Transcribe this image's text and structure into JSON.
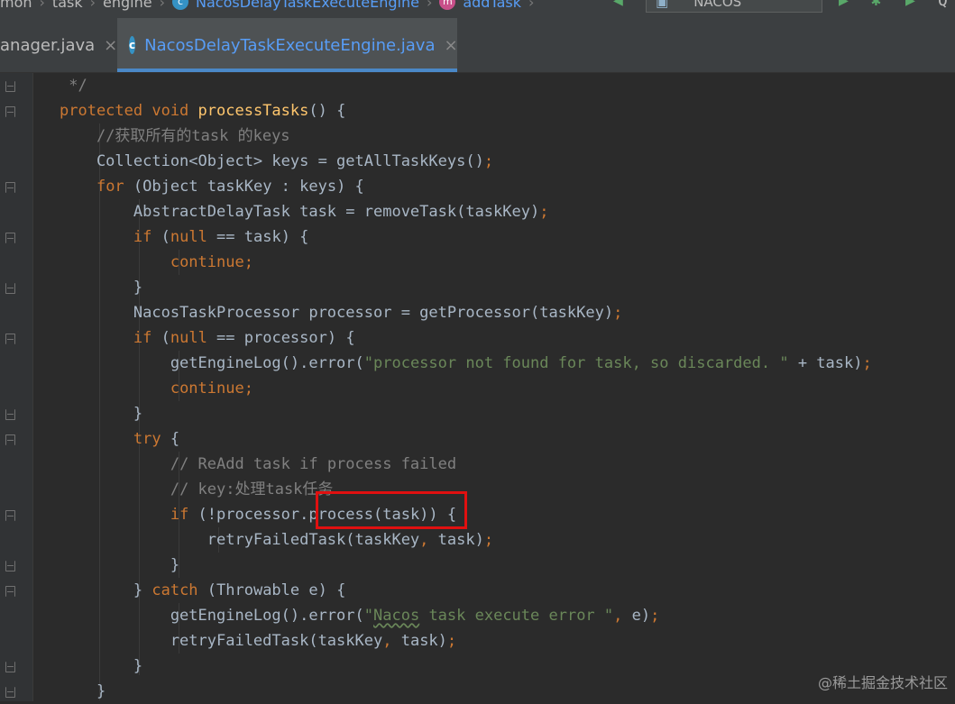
{
  "breadcrumb": [
    {
      "label": "mon"
    },
    {
      "label": "task"
    },
    {
      "label": "engine"
    },
    {
      "label": "NacosDelayTaskExecuteEngine"
    },
    {
      "label": "addTask"
    }
  ],
  "run_config": {
    "label": "NACOS"
  },
  "tabs": [
    {
      "label": "anager.java",
      "active": false
    },
    {
      "label": "NacosDelayTaskExecuteEngine.java",
      "active": true
    }
  ],
  "code_lines": [
    "<span class=\"cm\"> */</span>",
    "<span class=\"kw\">protected void </span><span class=\"fn\">processTasks</span>() {",
    "    <span class=\"cm\">//获取所有的task 的keys</span>",
    "    Collection&lt;Object&gt; keys = getAllTaskKeys()<span class=\"kw\">;</span>",
    "    <span class=\"kw\">for </span>(Object taskKey : keys) {",
    "        AbstractDelayTask task = removeTask(taskKey)<span class=\"kw\">;</span>",
    "        <span class=\"kw\">if </span>(<span class=\"kw\">null </span>== task) {",
    "            <span class=\"kw\">continue;</span>",
    "        }",
    "        NacosTaskProcessor processor = getProcessor(taskKey)<span class=\"kw\">;</span>",
    "        <span class=\"kw\">if </span>(<span class=\"kw\">null </span>== processor) {",
    "            getEngineLog().error(<span class=\"st\">\"processor not found for task, so discarded. \" </span>+ task)<span class=\"kw\">;</span>",
    "            <span class=\"kw\">continue;</span>",
    "        }",
    "        <span class=\"kw\">try </span>{",
    "            <span class=\"cm\">// ReAdd task if process failed</span>",
    "            <span class=\"cm\">// key:处理task任务</span>",
    "            <span class=\"kw\">if </span>(!processor.process(task)) {",
    "                retryFailedTask(taskKey<span class=\"kw\">, </span>task)<span class=\"kw\">;</span>",
    "            }",
    "        } <span class=\"kw\">catch </span>(Throwable e) {",
    "            getEngineLog().error(<span class=\"st\">\"<span class=\"wavy\">Nacos</span> task execute error \"</span><span class=\"kw\">, </span>e)<span class=\"kw\">;</span>",
    "            retryFailedTask(taskKey<span class=\"kw\">, </span>task)<span class=\"kw\">;</span>",
    "        }",
    "    }"
  ],
  "watermark": "@稀土掘金技术社区"
}
